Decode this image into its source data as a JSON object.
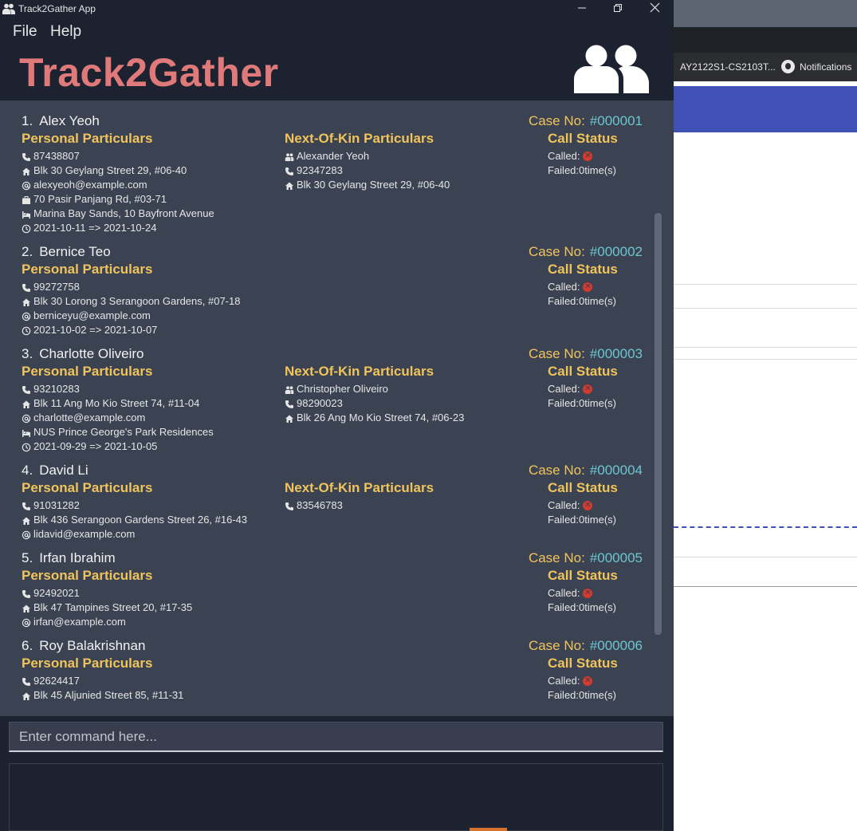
{
  "window": {
    "title": "Track2Gather App"
  },
  "menu": {
    "file": "File",
    "help": "Help"
  },
  "app": {
    "title": "Track2Gather"
  },
  "background_browser": {
    "repo_tab": "AY2122S1-CS2103T...",
    "notifications": "Notifications"
  },
  "labels": {
    "case_no": "Case No:",
    "personal": "Personal Particulars",
    "nok": "Next-Of-Kin Particulars",
    "call_status": "Call Status",
    "called": "Called:",
    "failed_prefix": "Failed: ",
    "failed_suffix": " time(s)"
  },
  "persons": [
    {
      "index": "1.",
      "name": "Alex Yeoh",
      "case_no": "#000001",
      "personal": [
        {
          "icon": "phone-icon",
          "text": "87438807"
        },
        {
          "icon": "home-icon",
          "text": "Blk 30 Geylang Street 29, #06-40"
        },
        {
          "icon": "email-icon",
          "text": "alexyeoh@example.com"
        },
        {
          "icon": "work-icon",
          "text": "70 Pasir Panjang Rd, #03-71"
        },
        {
          "icon": "hotel-icon",
          "text": "Marina Bay Sands, 10 Bayfront Avenue"
        },
        {
          "icon": "clock-icon",
          "text": "2021-10-11 => 2021-10-24"
        }
      ],
      "nok": [
        {
          "icon": "people-icon",
          "text": "Alexander Yeoh"
        },
        {
          "icon": "phone-icon",
          "text": "92347283"
        },
        {
          "icon": "home-icon",
          "text": "Blk 30 Geylang Street 29, #06-40"
        }
      ],
      "failed_count": "0"
    },
    {
      "index": "2.",
      "name": "Bernice Teo",
      "case_no": "#000002",
      "personal": [
        {
          "icon": "phone-icon",
          "text": "99272758"
        },
        {
          "icon": "home-icon",
          "text": "Blk 30 Lorong 3 Serangoon Gardens, #07-18"
        },
        {
          "icon": "email-icon",
          "text": "berniceyu@example.com"
        },
        {
          "icon": "clock-icon",
          "text": "2021-10-02 => 2021-10-07"
        }
      ],
      "nok": [],
      "failed_count": "0"
    },
    {
      "index": "3.",
      "name": "Charlotte Oliveiro",
      "case_no": "#000003",
      "personal": [
        {
          "icon": "phone-icon",
          "text": "93210283"
        },
        {
          "icon": "home-icon",
          "text": "Blk 11 Ang Mo Kio Street 74, #11-04"
        },
        {
          "icon": "email-icon",
          "text": "charlotte@example.com"
        },
        {
          "icon": "hotel-icon",
          "text": "NUS Prince George's Park Residences"
        },
        {
          "icon": "clock-icon",
          "text": "2021-09-29 => 2021-10-05"
        }
      ],
      "nok": [
        {
          "icon": "people-icon",
          "text": "Christopher Oliveiro"
        },
        {
          "icon": "phone-icon",
          "text": "98290023"
        },
        {
          "icon": "home-icon",
          "text": "Blk 26 Ang Mo Kio Street 74, #06-23"
        }
      ],
      "failed_count": "0"
    },
    {
      "index": "4.",
      "name": "David Li",
      "case_no": "#000004",
      "personal": [
        {
          "icon": "phone-icon",
          "text": "91031282"
        },
        {
          "icon": "home-icon",
          "text": "Blk 436 Serangoon Gardens Street 26, #16-43"
        },
        {
          "icon": "email-icon",
          "text": "lidavid@example.com"
        }
      ],
      "nok": [
        {
          "icon": "phone-icon",
          "text": "83546783"
        }
      ],
      "failed_count": "0"
    },
    {
      "index": "5.",
      "name": "Irfan Ibrahim",
      "case_no": "#000005",
      "personal": [
        {
          "icon": "phone-icon",
          "text": "92492021"
        },
        {
          "icon": "home-icon",
          "text": "Blk 47 Tampines Street 20, #17-35"
        },
        {
          "icon": "email-icon",
          "text": "irfan@example.com"
        }
      ],
      "nok": [],
      "failed_count": "0"
    },
    {
      "index": "6.",
      "name": "Roy Balakrishnan",
      "case_no": "#000006",
      "personal": [
        {
          "icon": "phone-icon",
          "text": "92624417"
        },
        {
          "icon": "home-icon",
          "text": "Blk 45 Aljunied Street 85, #11-31"
        }
      ],
      "nok": [],
      "failed_count": "0"
    }
  ],
  "command": {
    "placeholder": "Enter command here..."
  }
}
